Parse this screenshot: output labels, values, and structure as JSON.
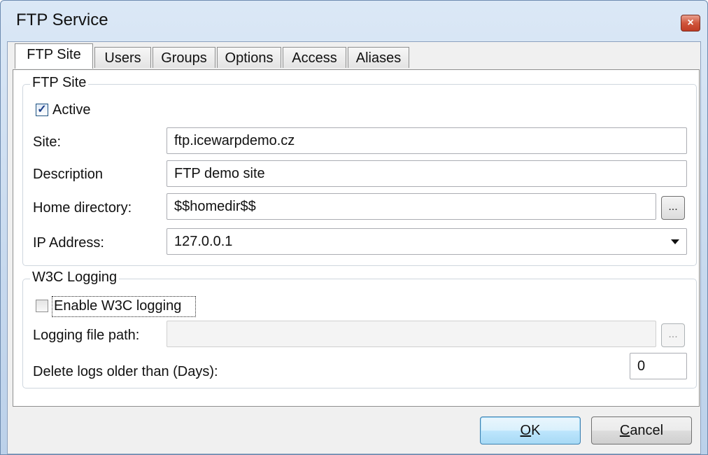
{
  "window": {
    "title": "FTP Service",
    "close_glyph": "×"
  },
  "tabs": [
    {
      "label": "FTP Site",
      "active": true
    },
    {
      "label": "Users",
      "active": false
    },
    {
      "label": "Groups",
      "active": false
    },
    {
      "label": "Options",
      "active": false
    },
    {
      "label": "Access",
      "active": false
    },
    {
      "label": "Aliases",
      "active": false
    }
  ],
  "ftp_site": {
    "group_title": "FTP Site",
    "active": {
      "label": "Active",
      "checked": true
    },
    "site": {
      "label": "Site:",
      "value": "ftp.icewarpdemo.cz"
    },
    "description": {
      "label": "Description",
      "value": "FTP demo site"
    },
    "home_directory": {
      "label": "Home directory:",
      "value": "$$homedir$$",
      "browse_label": "..."
    },
    "ip_address": {
      "label": "IP Address:",
      "value": "127.0.0.1"
    }
  },
  "w3c_logging": {
    "group_title": "W3C Logging",
    "enable": {
      "label": "Enable W3C logging",
      "checked": false
    },
    "logging_path": {
      "label": "Logging file path:",
      "value": "",
      "browse_label": "..."
    },
    "delete_logs": {
      "label": "Delete logs older than (Days):",
      "value": "0"
    }
  },
  "buttons": {
    "ok_accel": "O",
    "ok_rest": "K",
    "cancel_accel": "C",
    "cancel_rest": "ancel"
  },
  "colors": {
    "accent": "#3c7fb1",
    "close": "#c03c24"
  }
}
